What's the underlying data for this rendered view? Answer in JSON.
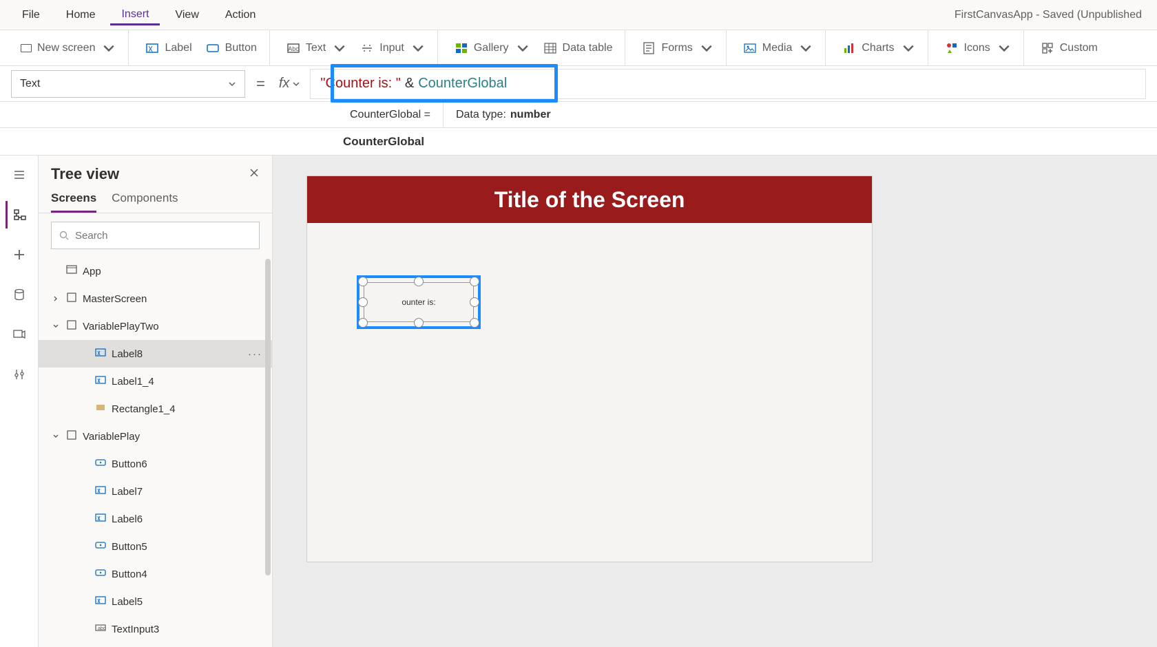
{
  "app": {
    "title": "FirstCanvasApp - Saved (Unpublished"
  },
  "menubar": [
    "File",
    "Home",
    "Insert",
    "View",
    "Action"
  ],
  "menubar_active": "Insert",
  "ribbon": {
    "new_screen": "New screen",
    "label": "Label",
    "button": "Button",
    "text": "Text",
    "input": "Input",
    "gallery": "Gallery",
    "data_table": "Data table",
    "forms": "Forms",
    "media": "Media",
    "charts": "Charts",
    "icons": "Icons",
    "custom": "Custom"
  },
  "formula": {
    "property": "Text",
    "fx_label": "fx",
    "string_token": "\"Counter is: \"",
    "op_token": "&",
    "var_token": "CounterGlobal"
  },
  "info": {
    "var_line": "CounterGlobal  =",
    "datatype_label": "Data type:",
    "datatype_value": "number"
  },
  "suggest": "CounterGlobal",
  "tree": {
    "title": "Tree view",
    "tabs": {
      "screens": "Screens",
      "components": "Components"
    },
    "search_placeholder": "Search",
    "items": [
      {
        "label": "App",
        "depth": 1,
        "icon": "app",
        "expand": ""
      },
      {
        "label": "MasterScreen",
        "depth": 1,
        "icon": "screen",
        "expand": "›"
      },
      {
        "label": "VariablePlayTwo",
        "depth": 1,
        "icon": "screen",
        "expand": "⌄"
      },
      {
        "label": "Label8",
        "depth": 3,
        "icon": "label",
        "selected": true
      },
      {
        "label": "Label1_4",
        "depth": 3,
        "icon": "label"
      },
      {
        "label": "Rectangle1_4",
        "depth": 3,
        "icon": "rect"
      },
      {
        "label": "VariablePlay",
        "depth": 1,
        "icon": "screen",
        "expand": "⌄"
      },
      {
        "label": "Button6",
        "depth": 3,
        "icon": "button"
      },
      {
        "label": "Label7",
        "depth": 3,
        "icon": "label"
      },
      {
        "label": "Label6",
        "depth": 3,
        "icon": "label"
      },
      {
        "label": "Button5",
        "depth": 3,
        "icon": "button"
      },
      {
        "label": "Button4",
        "depth": 3,
        "icon": "button"
      },
      {
        "label": "Label5",
        "depth": 3,
        "icon": "label"
      },
      {
        "label": "TextInput3",
        "depth": 3,
        "icon": "textinput"
      }
    ]
  },
  "canvas": {
    "screen_title": "Title of the Screen",
    "selected_text": "ounter is:"
  }
}
